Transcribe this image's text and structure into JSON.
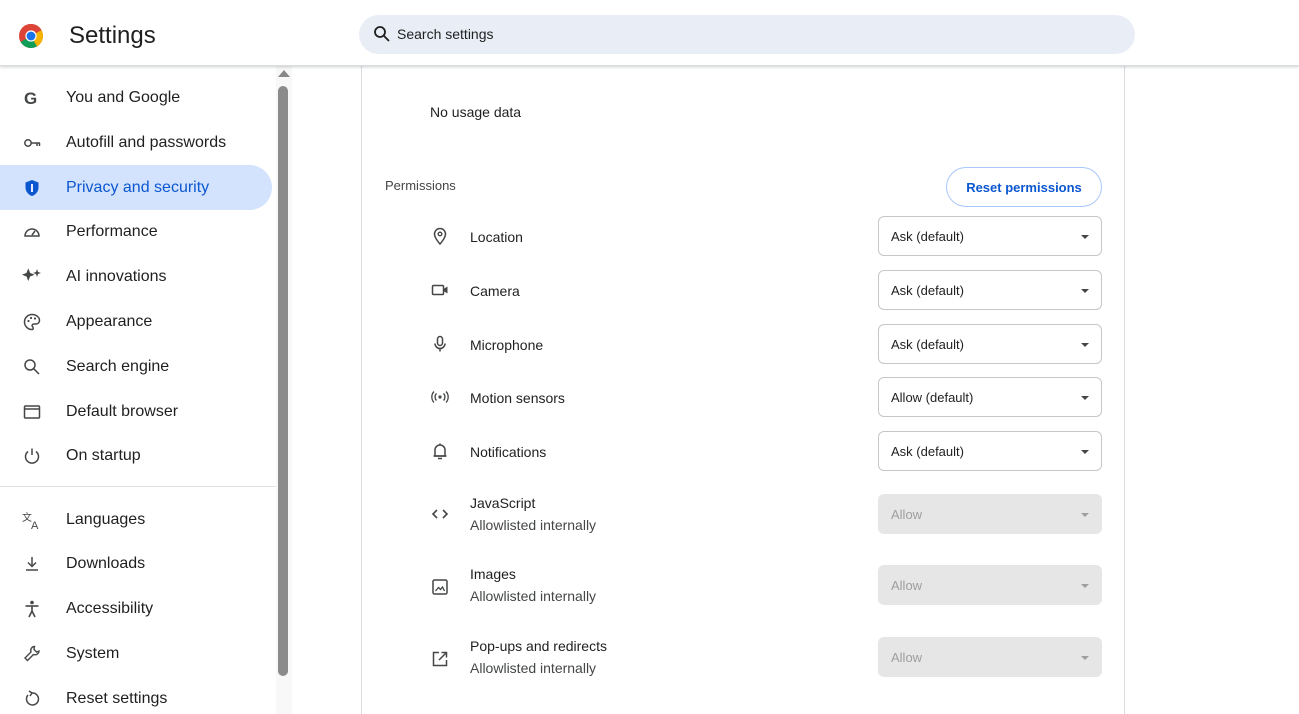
{
  "header": {
    "title": "Settings",
    "search_placeholder": "Search settings"
  },
  "sidebar": {
    "items": [
      {
        "label": "You and Google",
        "icon": "google-g-icon"
      },
      {
        "label": "Autofill and passwords",
        "icon": "key-icon"
      },
      {
        "label": "Privacy and security",
        "icon": "shield-icon",
        "active": true
      },
      {
        "label": "Performance",
        "icon": "speedometer-icon"
      },
      {
        "label": "AI innovations",
        "icon": "sparkle-icon"
      },
      {
        "label": "Appearance",
        "icon": "palette-icon"
      },
      {
        "label": "Search engine",
        "icon": "search-icon"
      },
      {
        "label": "Default browser",
        "icon": "browser-window-icon"
      },
      {
        "label": "On startup",
        "icon": "power-icon"
      },
      {
        "label": "Languages",
        "icon": "translate-icon"
      },
      {
        "label": "Downloads",
        "icon": "download-icon"
      },
      {
        "label": "Accessibility",
        "icon": "accessibility-icon"
      },
      {
        "label": "System",
        "icon": "wrench-icon"
      },
      {
        "label": "Reset settings",
        "icon": "reset-icon"
      }
    ]
  },
  "main": {
    "usage_text": "No usage data",
    "permissions_title": "Permissions",
    "reset_label": "Reset permissions",
    "permissions": [
      {
        "name": "Location",
        "value": "Ask (default)",
        "icon": "location-pin-icon"
      },
      {
        "name": "Camera",
        "value": "Ask (default)",
        "icon": "camera-icon"
      },
      {
        "name": "Microphone",
        "value": "Ask (default)",
        "icon": "microphone-icon"
      },
      {
        "name": "Motion sensors",
        "value": "Allow (default)",
        "icon": "motion-sensor-icon"
      },
      {
        "name": "Notifications",
        "value": "Ask (default)",
        "icon": "bell-icon"
      },
      {
        "name": "JavaScript",
        "sub": "Allowlisted internally",
        "value": "Allow",
        "icon": "code-icon",
        "disabled": true
      },
      {
        "name": "Images",
        "sub": "Allowlisted internally",
        "value": "Allow",
        "icon": "image-icon",
        "disabled": true
      },
      {
        "name": "Pop-ups and redirects",
        "sub": "Allowlisted internally",
        "value": "Allow",
        "icon": "external-link-icon",
        "disabled": true
      }
    ]
  },
  "colors": {
    "accent": "#0b57d0",
    "active_bg": "#d3e3fd",
    "search_bg": "#e9eef6"
  }
}
